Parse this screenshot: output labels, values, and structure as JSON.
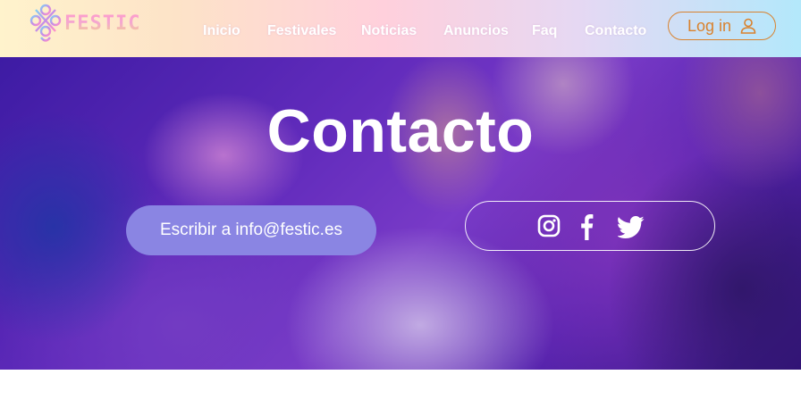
{
  "header": {
    "logo_text": "FESTIC",
    "nav": [
      {
        "label": "Inicio"
      },
      {
        "label": "Festivales"
      },
      {
        "label": "Noticias"
      },
      {
        "label": "Anuncios"
      },
      {
        "label": "Faq"
      },
      {
        "label": "Contacto"
      }
    ],
    "login_label": "Log in",
    "login_icon": "user-icon"
  },
  "hero": {
    "title": "Contacto",
    "email_button_label": "Escribir a info@festic.es",
    "social": [
      {
        "name": "instagram-icon"
      },
      {
        "name": "facebook-icon"
      },
      {
        "name": "twitter-icon"
      }
    ]
  },
  "colors": {
    "login_accent": "#d9822e",
    "email_button_bg": "#8a85e3",
    "logo_pink": "#ff9acb",
    "logo_gold": "#f2d38c"
  }
}
